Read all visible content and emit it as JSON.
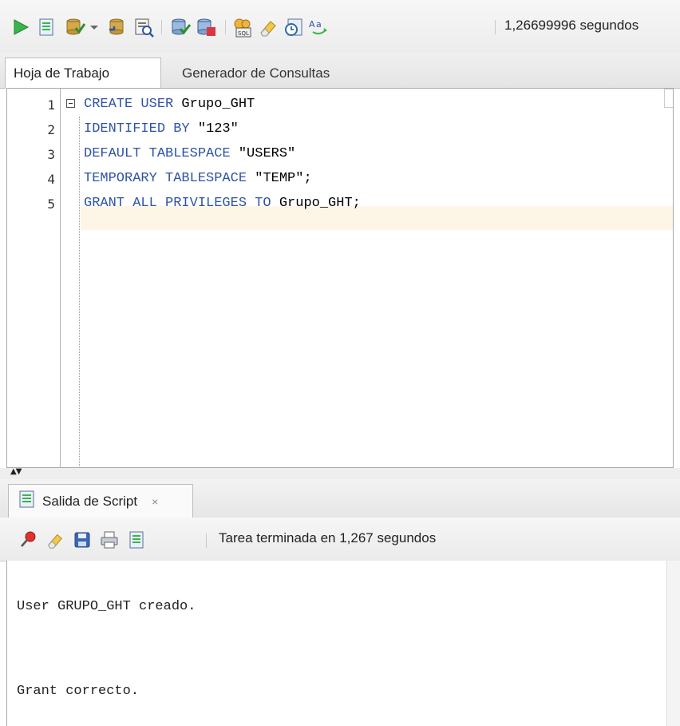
{
  "toolbar": {
    "status": "1,26699996 segundos",
    "icons": [
      "run-statement-icon",
      "run-script-icon",
      "commit-icon",
      "dropdown-icon",
      "rollback-icon",
      "explain-plan-icon",
      "autotrace-icon",
      "sql-tuning-icon",
      "sql-history-icon",
      "clear-icon",
      "sql-worksheet-history-icon",
      "format-case-icon"
    ]
  },
  "tabs": [
    {
      "label": "Hoja de Trabajo",
      "active": true
    },
    {
      "label": "Generador de Consultas",
      "active": false
    }
  ],
  "editor": {
    "line_numbers": [
      "1",
      "2",
      "3",
      "4",
      "5"
    ],
    "lines": [
      {
        "kw": "CREATE USER ",
        "rest": "Grupo_GHT"
      },
      {
        "kw": "IDENTIFIED BY ",
        "rest": "\"123\""
      },
      {
        "kw": "DEFAULT TABLESPACE ",
        "rest": "\"USERS\""
      },
      {
        "kw": "TEMPORARY TABLESPACE ",
        "rest": "\"TEMP\";"
      },
      {
        "kw": "GRANT ALL PRIVILEGES TO ",
        "rest": "Grupo_GHT;"
      }
    ]
  },
  "output_panel": {
    "tab_label": "Salida de Script",
    "close_label": "×",
    "status": "Tarea terminada en 1,267 segundos",
    "lines": [
      "User GRUPO_GHT creado.",
      "Grant correcto."
    ]
  },
  "colors": {
    "keyword": "#2d54a5",
    "current_line": "#fdf6e6"
  }
}
